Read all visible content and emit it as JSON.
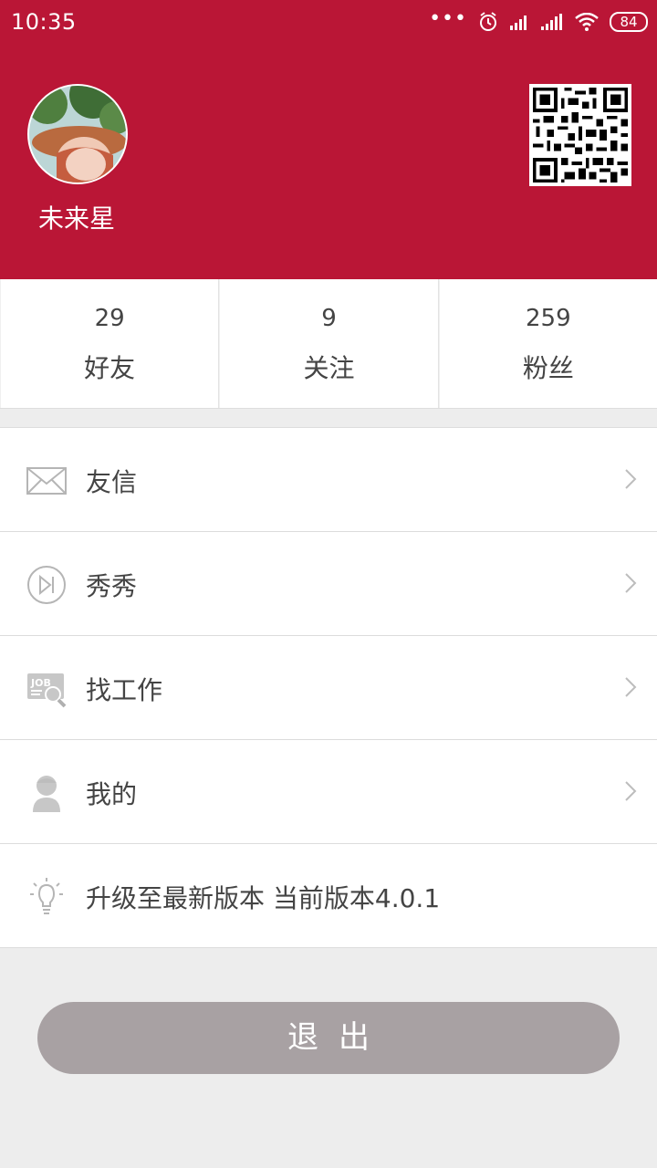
{
  "status_bar": {
    "time": "10:35",
    "dots": "•••",
    "battery": "84"
  },
  "profile": {
    "username": "未来星"
  },
  "stats": [
    {
      "count": "29",
      "label": "好友"
    },
    {
      "count": "9",
      "label": "关注"
    },
    {
      "count": "259",
      "label": "粉丝"
    }
  ],
  "menu": [
    {
      "label": "友信",
      "icon": "mail-icon"
    },
    {
      "label": "秀秀",
      "icon": "play-circle-icon"
    },
    {
      "label": "找工作",
      "icon": "job-search-icon"
    },
    {
      "label": "我的",
      "icon": "user-icon"
    },
    {
      "label": "升级至最新版本 当前版本4.0.1",
      "icon": "lightbulb-icon"
    }
  ],
  "logout_label": "退出",
  "colors": {
    "header": "#ba1636",
    "background": "#ededed",
    "logout_button": "#a8a1a3"
  }
}
